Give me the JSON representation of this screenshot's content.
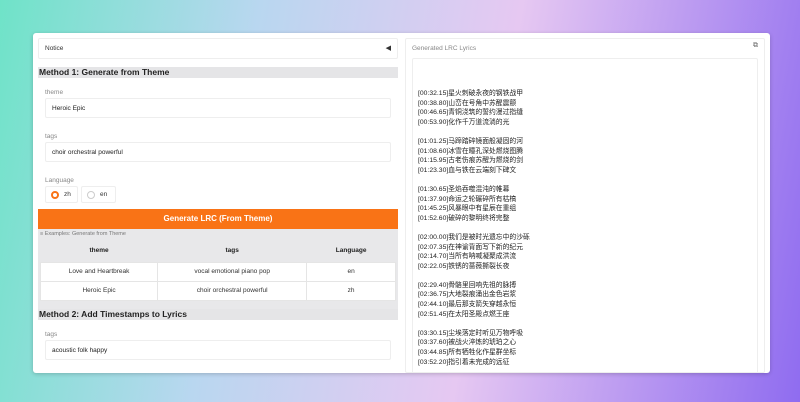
{
  "notice": {
    "label": "Notice",
    "toggle_icon": "triangle-left-icon"
  },
  "method1": {
    "title": "Method 1: Generate from Theme",
    "theme_label": "theme",
    "theme_value": "Heroic Epic",
    "tags_label": "tags",
    "tags_value": "choir orchestral powerful",
    "language_label": "Language",
    "options": [
      "zh",
      "en"
    ],
    "selected": "zh",
    "button": "Generate LRC (From Theme)"
  },
  "examples": {
    "caption": "≡ Examples: Generate from Theme",
    "headers": [
      "theme",
      "tags",
      "Language"
    ],
    "rows": [
      [
        "Love and Heartbreak",
        "vocal emotional piano pop",
        "en"
      ],
      [
        "Heroic Epic",
        "choir orchestral powerful",
        "zh"
      ]
    ]
  },
  "method2": {
    "title": "Method 2: Add Timestamps to Lyrics",
    "tags_label": "tags",
    "tags_value": "acoustic folk happy"
  },
  "output": {
    "title": "Generated LRC Lyrics",
    "copy_icon": "copy-icon",
    "lyrics": "[00:32.15]星火刺破永夜的钢铁战甲\n[00:38.80]山峦在号角中苏醒震颤\n[00:46.65]青铜浇筑的誓约漫过指缝\n[00:53.90]化作千万道流淌的光\n\n[01:01.25]马蹄踏碎镜面般凝固的河\n[01:08.60]冰雪在瞳孔深处燃烧图腾\n[01:15.95]古老伤痕苏醒为燃烧的剑\n[01:23.30]血与铁在云端刻下碑文\n\n[01:30.65]圣焰吞噬混沌的帷幕\n[01:37.90]命运之轮碾碎所有枯槁\n[01:45.25]风暴眼中有星辰在重组\n[01:52.60]破碎的黎明终将完整\n\n[02:00.00]我们是被时光遗忘中的沙砾\n[02:07.35]在神谕背面写下新的纪元\n[02:14.70]当所有呐喊凝聚成洪流\n[02:22.05]铁锈的蔷薇撕裂长夜\n\n[02:29.40]骨骼里回响先祖的脉搏\n[02:36.75]大地裂痕涌出金色岩浆\n[02:44.10]最后那支箭矢穿越永恒\n[02:51.45]在太阳圣殿点燃王座\n\n[03:30.15]尘埃落定时听见万物呼吸\n[03:37.60]被战火淬炼的琥珀之心\n[03:44.85]所有牺牲化作星群坐标\n[03:52.20]指引着未完成的远征"
  },
  "colors": {
    "accent": "#f97316",
    "header_bg": "#e5e5e7"
  }
}
